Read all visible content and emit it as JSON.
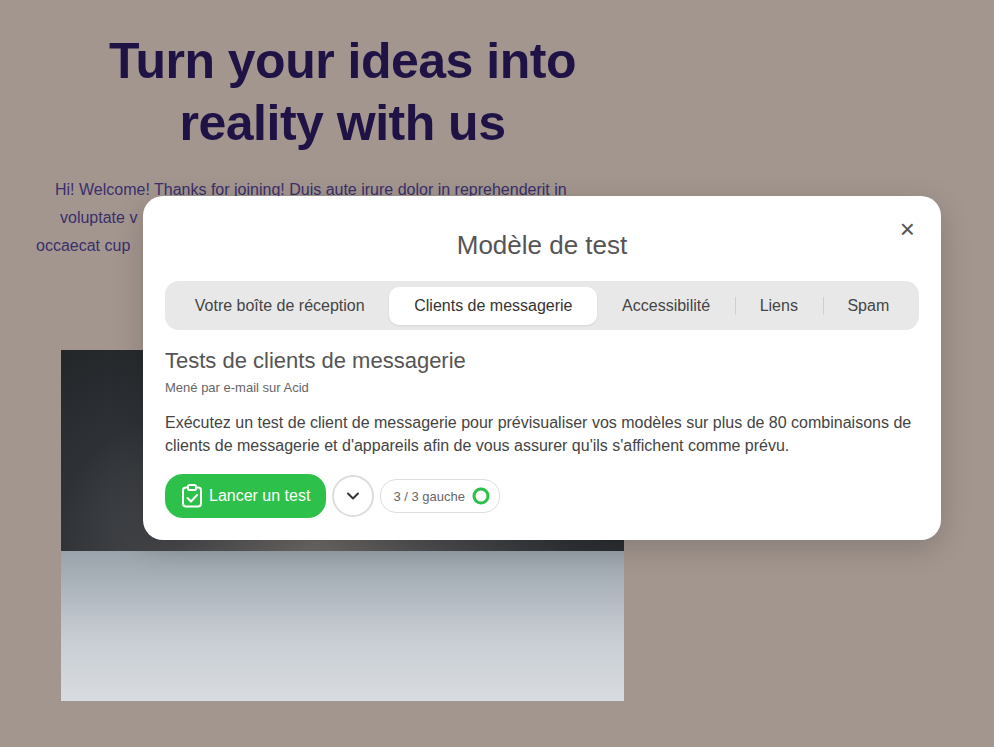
{
  "hero": {
    "heading": [
      "Turn your ideas into",
      "reality with us"
    ],
    "intro": [
      "Hi! Welcome! Thanks for joining! Duis aute irure dolor in reprehenderit in",
      "voluptate v",
      "occaecat cup"
    ]
  },
  "modal": {
    "title": "Modèle de test",
    "close": "×",
    "tabs": [
      {
        "label": "Votre boîte de réception",
        "selected": false
      },
      {
        "label": "Clients de messagerie",
        "selected": true
      },
      {
        "label": "Accessibilité",
        "selected": false
      },
      {
        "label": "Liens",
        "selected": false
      },
      {
        "label": "Spam",
        "selected": false
      }
    ],
    "section": {
      "title": "Tests de clients de messagerie",
      "subtitle": "Mené par e-mail sur Acid",
      "description": "Exécutez un test de client de messagerie pour prévisualiser vos modèles sur plus de 80 combinaisons de clients de messagerie et d'appareils afin de vous assurer qu'ils s'affichent comme prévu."
    },
    "primary_button": "Lancer un test",
    "quota": {
      "text": "3 / 3 gauche",
      "level": 1
    }
  }
}
